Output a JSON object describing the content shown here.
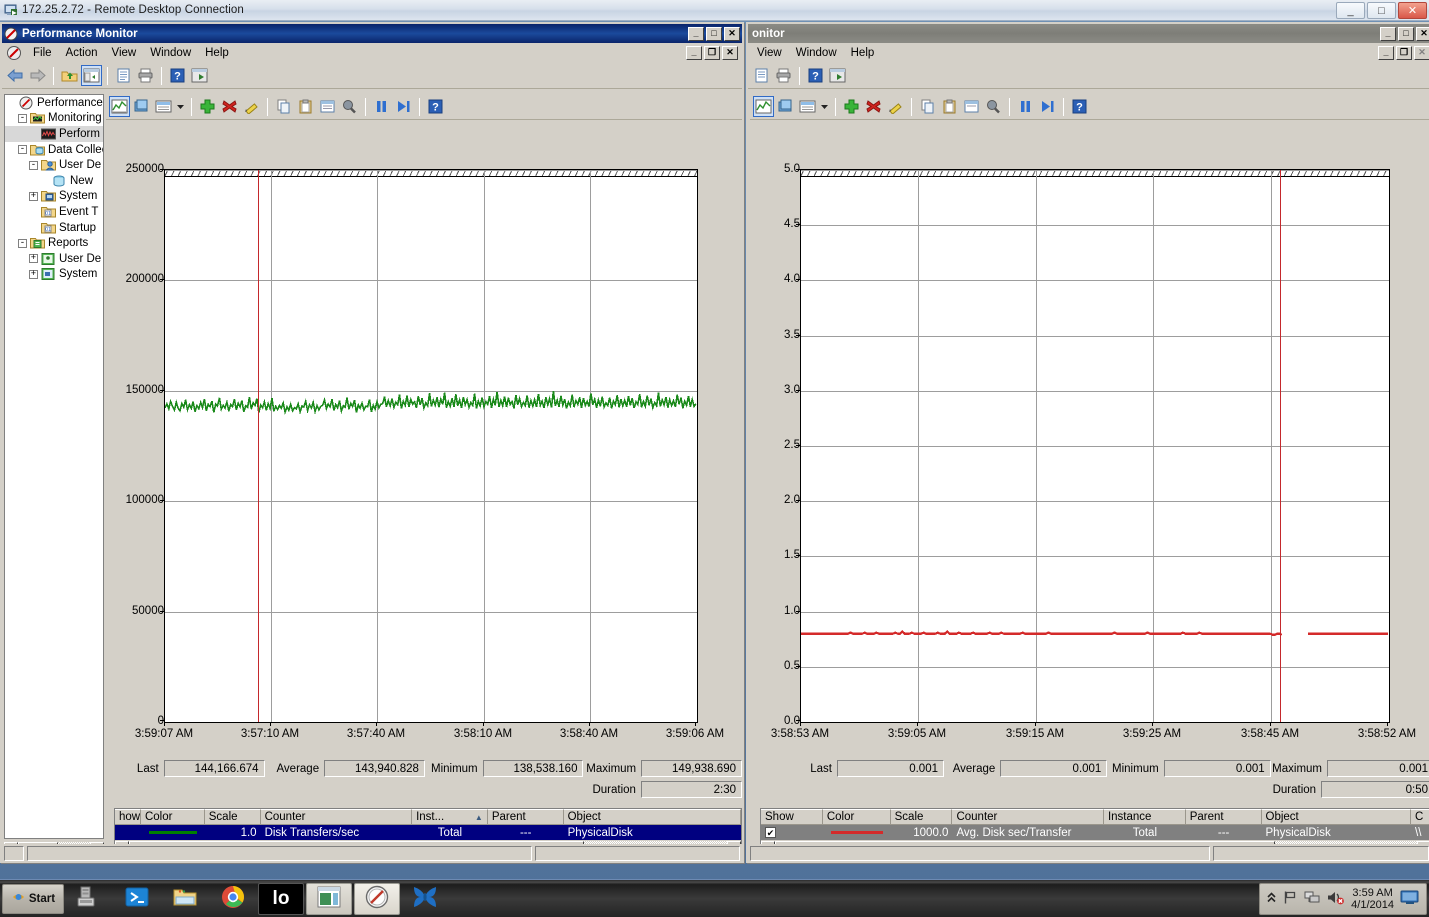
{
  "rdp": {
    "title": "172.25.2.72 - Remote Desktop Connection",
    "icon": "remote-desktop-icon",
    "minimize": "_",
    "maximize": "□",
    "close": "✕"
  },
  "left_window": {
    "title": "Performance Monitor",
    "icon": "performance-monitor-icon",
    "sys": {
      "minimize": "_",
      "maximize": "□",
      "close": "✕"
    },
    "mdi": {
      "minimize": "_",
      "restore": "❐",
      "close": "✕"
    },
    "menu": [
      "File",
      "Action",
      "View",
      "Window",
      "Help"
    ],
    "console_toolbar": [
      "back-icon",
      "forward-icon",
      "up-folder-icon",
      "show-tree-icon",
      "properties-icon",
      "print-icon",
      "help-icon",
      "new-window-icon"
    ],
    "graph_toolbar": [
      "chart-view-icon",
      "histogram-view-icon",
      "report-view-icon",
      "view-dropdown-icon",
      "add-counter-icon",
      "delete-counter-icon",
      "highlight-icon",
      "copy-icon",
      "paste-icon",
      "properties-icon",
      "zoom-icon",
      "freeze-display-icon",
      "update-data-icon",
      "help-icon"
    ],
    "tree": [
      {
        "label": "Performance",
        "depth": 0,
        "toggle": "none",
        "icon": "performance-root-icon",
        "selected": false
      },
      {
        "label": "Monitoring T",
        "depth": 1,
        "toggle": "-",
        "icon": "monitoring-tools-folder-icon",
        "selected": false
      },
      {
        "label": "Perform",
        "depth": 2,
        "toggle": "none",
        "icon": "performance-monitor-icon",
        "selected": true
      },
      {
        "label": "Data Collec",
        "depth": 1,
        "toggle": "-",
        "icon": "data-collector-folder-icon",
        "selected": false
      },
      {
        "label": "User De",
        "depth": 2,
        "toggle": "-",
        "icon": "user-defined-icon",
        "selected": false
      },
      {
        "label": "New",
        "depth": 3,
        "toggle": "none",
        "icon": "new-data-collector-icon",
        "selected": false
      },
      {
        "label": "System",
        "depth": 2,
        "toggle": "+",
        "icon": "system-folder-icon",
        "selected": false
      },
      {
        "label": "Event T",
        "depth": 2,
        "toggle": "none",
        "icon": "event-trace-icon",
        "selected": false
      },
      {
        "label": "Startup",
        "depth": 2,
        "toggle": "none",
        "icon": "startup-event-icon",
        "selected": false
      },
      {
        "label": "Reports",
        "depth": 1,
        "toggle": "-",
        "icon": "reports-folder-icon",
        "selected": false
      },
      {
        "label": "User De",
        "depth": 2,
        "toggle": "+",
        "icon": "user-defined-reports-icon",
        "selected": false
      },
      {
        "label": "System",
        "depth": 2,
        "toggle": "+",
        "icon": "system-reports-icon",
        "selected": false
      }
    ],
    "stats": {
      "last_label": "Last",
      "last_value": "144,166.674",
      "average_label": "Average",
      "average_value": "143,940.828",
      "minimum_label": "Minimum",
      "minimum_value": "138,538.160",
      "maximum_label": "Maximum",
      "maximum_value": "149,938.690",
      "duration_label": "Duration",
      "duration_value": "2:30"
    },
    "legend": {
      "columns": [
        "how",
        "Color",
        "Scale",
        "Counter",
        "Inst...",
        "Parent",
        "Object"
      ],
      "sort_col": "Inst...",
      "sort_arrow": "▲",
      "rows": [
        {
          "show": "",
          "color": "#008000",
          "scale": "1.0",
          "counter": "Disk Transfers/sec",
          "instance": "Total",
          "parent": "---",
          "object": "PhysicalDisk",
          "selected": true
        }
      ]
    }
  },
  "right_window": {
    "title": "onitor",
    "sys": {
      "minimize": "_",
      "maximize": "□",
      "close": "✕"
    },
    "mdi": {
      "minimize": "_",
      "restore": "❐",
      "close": "✕"
    },
    "menu": [
      "View",
      "Window",
      "Help"
    ],
    "console_toolbar": [
      "properties-icon",
      "print-icon",
      "help-icon",
      "new-window-icon"
    ],
    "graph_toolbar": [
      "chart-view-icon",
      "histogram-view-icon",
      "report-view-icon",
      "view-dropdown-icon",
      "add-counter-icon",
      "delete-counter-icon",
      "highlight-icon",
      "copy-icon",
      "paste-icon",
      "properties-icon",
      "zoom-icon",
      "freeze-display-icon",
      "update-data-icon",
      "help-icon"
    ],
    "stats": {
      "last_label": "Last",
      "last_value": "0.001",
      "average_label": "Average",
      "average_value": "0.001",
      "minimum_label": "Minimum",
      "minimum_value": "0.001",
      "maximum_label": "Maximum",
      "maximum_value": "0.001",
      "duration_label": "Duration",
      "duration_value": "0:50"
    },
    "legend": {
      "columns": [
        "Show",
        "Color",
        "Scale",
        "Counter",
        "Instance",
        "Parent",
        "Object",
        "C"
      ],
      "rows": [
        {
          "show": "✔",
          "color": "#d42a2a",
          "scale": "1000.0",
          "counter": "Avg. Disk sec/Transfer",
          "instance": "Total",
          "parent": "---",
          "object": "PhysicalDisk",
          "extra": "\\\\",
          "selected": true
        }
      ]
    }
  },
  "taskbar": {
    "start_label": "Start",
    "buttons": [
      {
        "name": "server-manager-icon",
        "style": "plain"
      },
      {
        "name": "powershell-icon",
        "style": "plain"
      },
      {
        "name": "file-explorer-icon",
        "style": "plain"
      },
      {
        "name": "chrome-icon",
        "style": "plain"
      },
      {
        "name": "io-console-icon",
        "style": "dark",
        "label": "lo"
      },
      {
        "name": "window-app-icon",
        "style": "lite"
      },
      {
        "name": "performance-monitor-icon",
        "style": "active"
      },
      {
        "name": "butterfly-app-icon",
        "style": "plain"
      }
    ],
    "tray": [
      "show-hidden-icons-chevron",
      "action-center-flag-icon",
      "network-icon",
      "volume-muted-icon"
    ],
    "clock_time": "3:59 AM",
    "clock_date": "4/1/2014",
    "show_desktop": "show-desktop-button"
  },
  "chart_data": [
    {
      "id": "left",
      "type": "line",
      "title": "Disk Transfers/sec",
      "xlabel": "",
      "ylabel": "",
      "ylim": [
        0,
        250000
      ],
      "yticks": [
        0,
        50000,
        100000,
        150000,
        200000,
        250000
      ],
      "ytick_labels": [
        "0",
        "50000",
        "100000",
        "150000",
        "200000",
        "250000"
      ],
      "xtick_labels": [
        "3:59:07 AM",
        "3:57:10 AM",
        "3:57:40 AM",
        "3:58:10 AM",
        "3:58:40 AM",
        "3:59:06 AM"
      ],
      "grid": true,
      "legend_position": "bottom-table",
      "cursor_x_frac": 0.175,
      "series": [
        {
          "name": "Disk Transfers/sec",
          "color": "#1a8a1a",
          "scale": 1.0,
          "values": [
            142300,
            144100,
            141800,
            145200,
            143000,
            141200,
            144800,
            142100,
            140900,
            144300,
            142600,
            145900,
            141400,
            143700,
            142000,
            145100,
            140600,
            143300,
            141900,
            144700,
            142400,
            146300,
            141000,
            143900,
            142800,
            145400,
            140200,
            144000,
            143100,
            146800,
            141600,
            143500,
            142200,
            144900,
            140800,
            143800,
            142900,
            146100,
            141300,
            144400,
            142700,
            145600,
            140400,
            143200,
            142500,
            147100,
            141700,
            144600,
            143400,
            146500,
            140100,
            143600,
            142300,
            145000,
            141100,
            144200,
            142000,
            146700,
            140700,
            143000,
            141500,
            143400,
            142100,
            144500,
            140300,
            142800,
            141200,
            143900,
            140900,
            142400,
            141800,
            144100,
            140500,
            143100,
            142600,
            145200,
            141000,
            143700,
            142200,
            144800,
            140600,
            143300,
            141400,
            142900,
            143500,
            145900,
            141900,
            144000,
            142700,
            146200,
            141100,
            143800,
            142300,
            145500,
            140800,
            143200,
            142500,
            146900,
            141600,
            144300,
            142900,
            145700,
            140200,
            143600,
            142100,
            144400,
            141300,
            143000,
            142800,
            146000,
            140400,
            143500,
            141700,
            145100,
            142200,
            143900,
            144200,
            147300,
            142800,
            145600,
            143100,
            146400,
            142500,
            144900,
            143700,
            148200,
            142000,
            145300,
            143400,
            147800,
            142700,
            146100,
            143900,
            145000,
            142300,
            147500,
            143600,
            146700,
            142100,
            144600,
            143200,
            148900,
            142900,
            145800,
            143500,
            147000,
            142600,
            146300,
            143800,
            149200,
            142400,
            145100,
            143000,
            146600,
            142800,
            148400,
            143300,
            145900,
            142200,
            147200,
            143700,
            146000,
            142500,
            144700,
            143400,
            148700,
            142000,
            145400,
            143100,
            146900,
            142700,
            145200,
            143900,
            147600,
            142300,
            146200,
            143500,
            149500,
            142800,
            145700,
            143200,
            147400,
            142600,
            146800,
            143800,
            145100,
            142100,
            148100,
            143600,
            146500,
            142900,
            144800,
            143300,
            147900,
            142400,
            145500,
            143000,
            146000,
            142700,
            148600,
            143400,
            145300,
            142200,
            147100,
            143700,
            146400,
            142500,
            149900,
            143100,
            145800,
            142800,
            147700,
            143500,
            146200,
            142000,
            144900,
            143200,
            148300,
            142600,
            145600,
            143800,
            147000,
            142300,
            146700,
            143400,
            145200,
            142900,
            148800,
            143600,
            146100,
            142400,
            145900,
            143000,
            147300,
            142700,
            144500,
            143300,
            146900,
            142100,
            145400,
            143700,
            148000,
            142500,
            146300,
            143100,
            145700,
            142800,
            147500,
            143400,
            146600,
            142200,
            145000,
            143800,
            148500,
            142600,
            145200,
            143000,
            147800,
            143500,
            146400,
            142300,
            144700,
            143200,
            149100,
            142900,
            145900,
            143600,
            147200,
            142400,
            146000,
            143300,
            145500,
            142700,
            148200,
            143900,
            146800,
            142100,
            145300,
            143400,
            147600,
            142800,
            146100,
            143000,
            144166
          ]
        }
      ]
    },
    {
      "id": "right",
      "type": "line",
      "title": "Avg. Disk sec/Transfer",
      "xlabel": "",
      "ylabel": "",
      "ylim": [
        0.0,
        5.0
      ],
      "yticks": [
        0.0,
        0.5,
        1.0,
        1.5,
        2.0,
        2.5,
        3.0,
        3.5,
        4.0,
        4.5,
        5.0
      ],
      "ytick_labels": [
        "0.0",
        "0.5",
        "1.0",
        "1.5",
        "2.0",
        "2.5",
        "3.0",
        "3.5",
        "4.0",
        "4.5",
        "5.0"
      ],
      "xtick_labels": [
        "3:58:53 AM",
        "3:59:05 AM",
        "3:59:15 AM",
        "3:59:25 AM",
        "3:58:45 AM",
        "3:58:52 AM"
      ],
      "grid": true,
      "legend_position": "bottom-table",
      "cursor_x_frac": 0.815,
      "gap_frac": [
        0.822,
        0.862
      ],
      "series": [
        {
          "name": "Avg. Disk sec/Transfer",
          "color": "#d42a2a",
          "scale": 1000.0,
          "values": [
            0.8,
            0.8,
            0.8,
            0.8,
            0.8,
            0.8,
            0.8,
            0.8,
            0.8,
            0.8,
            0.8,
            0.8,
            0.8,
            0.8,
            0.8,
            0.8,
            0.8,
            0.8,
            0.8,
            0.8,
            0.8,
            0.81,
            0.8,
            0.8,
            0.8,
            0.8,
            0.8,
            0.81,
            0.8,
            0.8,
            0.8,
            0.8,
            0.81,
            0.8,
            0.8,
            0.8,
            0.8,
            0.8,
            0.8,
            0.8,
            0.81,
            0.8,
            0.8,
            0.82,
            0.8,
            0.8,
            0.8,
            0.81,
            0.8,
            0.8,
            0.8,
            0.8,
            0.81,
            0.8,
            0.8,
            0.8,
            0.8,
            0.8,
            0.81,
            0.8,
            0.8,
            0.8,
            0.82,
            0.8,
            0.8,
            0.8,
            0.8,
            0.81,
            0.8,
            0.8,
            0.8,
            0.8,
            0.8,
            0.81,
            0.8,
            0.8,
            0.8,
            0.8,
            0.8,
            0.8,
            0.81,
            0.8,
            0.8,
            0.8,
            0.8,
            0.81,
            0.8,
            0.8,
            0.8,
            0.8,
            0.8,
            0.8,
            0.8,
            0.8,
            0.81,
            0.8,
            0.8,
            0.8,
            0.8,
            0.8,
            0.8,
            0.8,
            0.8,
            0.8,
            0.8,
            0.81,
            0.8,
            0.8,
            0.8,
            0.8,
            0.8,
            0.8,
            0.8,
            0.8,
            0.8,
            0.8,
            0.8,
            0.8,
            0.8,
            0.8,
            0.8,
            0.8,
            0.8,
            0.8,
            0.8,
            0.8,
            0.8,
            0.8,
            0.8,
            0.8,
            0.8,
            0.8,
            0.8,
            0.81,
            0.8,
            0.8,
            0.8,
            0.8,
            0.8,
            0.8,
            0.8,
            0.8,
            0.8,
            0.8,
            0.8,
            0.8,
            0.8,
            0.81,
            0.8,
            0.8,
            0.8,
            0.8,
            0.8,
            0.8,
            0.8,
            0.8,
            0.8,
            0.8,
            0.8,
            0.8,
            0.8,
            0.8,
            0.81,
            0.8,
            0.8,
            0.8,
            0.8,
            0.8,
            0.8,
            0.81,
            0.8,
            0.8,
            0.8,
            0.8,
            0.8,
            0.8,
            0.8,
            0.8,
            0.8,
            0.8,
            0.8,
            0.8,
            0.8,
            0.8,
            0.8,
            0.8,
            0.8,
            0.8,
            0.8,
            0.8,
            0.8,
            0.8,
            0.8,
            0.8,
            0.8,
            0.8,
            0.8,
            0.8,
            0.8,
            0.8,
            0.79,
            0.79,
            0.8,
            0.8,
            0.79,
            0.8,
            0.8,
            0.8,
            0.8,
            0.8,
            0.8,
            0.8,
            0.8,
            0.8,
            0.8,
            0.8,
            0.8,
            0.8,
            0.8,
            0.8,
            0.8,
            0.8,
            0.8,
            0.8,
            0.8,
            0.8,
            0.8,
            0.8,
            0.8,
            0.8,
            0.8,
            0.8,
            0.8,
            0.8,
            0.8,
            0.8,
            0.8,
            0.8,
            0.8,
            0.8,
            0.8,
            0.8,
            0.8,
            0.8,
            0.8,
            0.8,
            0.8,
            0.8,
            0.8,
            0.8
          ]
        }
      ]
    }
  ]
}
